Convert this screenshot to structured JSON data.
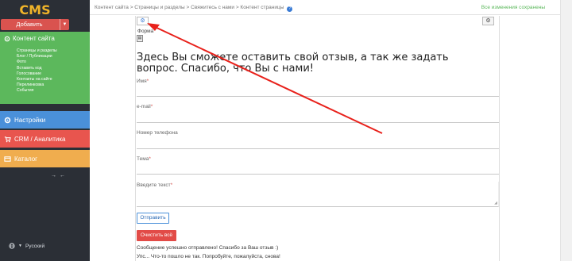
{
  "sidebar": {
    "logo": "CMS",
    "add_button": "Добавить",
    "content_section": {
      "label": "Контент сайта",
      "items": [
        "Страницы и разделы",
        "Блог / Публикации",
        "Фото",
        "Вставить код",
        "Голосование",
        "Контакты на сайте",
        "Перелинковка",
        "События"
      ]
    },
    "settings_label": "Настройки",
    "crm_label": "CRM / Аналитика",
    "catalog_label": "Каталог",
    "language": "Русский",
    "colors": {
      "content": "#5cb85c",
      "settings": "#4a90d9",
      "crm": "#e8554e",
      "catalog": "#f0ad4e",
      "add": "#d9534f"
    }
  },
  "breadcrumbs": "Контент сайта > Страницы и разделы > Свяжитесь с нами > Контент страницы",
  "saved_status": "Все изменения сохранены",
  "panel": {
    "block_label": "Форма",
    "headline": "Здесь Вы сможете оставить свой отзыв, а так же задать вопрос. Спасибо, что Вы с нами!",
    "fields": [
      {
        "label": "Имя",
        "required": true
      },
      {
        "label": "e-mail",
        "required": true
      },
      {
        "label": "Номер телефона",
        "required": false
      },
      {
        "label": "Тема",
        "required": true
      },
      {
        "label": "Введите текст",
        "required": true
      }
    ],
    "submit_label": "Отправить",
    "clear_label": "Очистить всё",
    "success_message": "Сообщение успешно отправлено! Спасибо за Ваш отзыв :)",
    "error_message": "Упс... Что-то пошло не так. Попробуйте, пожалуйста, снова!"
  },
  "icons": [
    "gear-icon",
    "help-icon",
    "globe-icon",
    "form-icon",
    "arrow-annotation"
  ]
}
